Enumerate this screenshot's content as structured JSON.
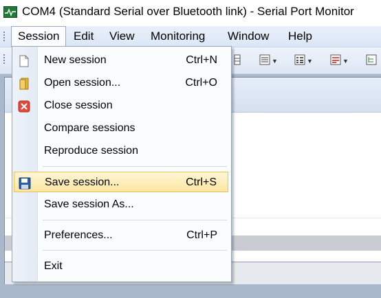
{
  "window": {
    "title": "COM4 (Standard Serial over Bluetooth link) - Serial Port Monitor"
  },
  "menubar": {
    "items": [
      {
        "label": "Session",
        "active": true
      },
      {
        "label": "Edit"
      },
      {
        "label": "View"
      },
      {
        "label": "Monitoring"
      },
      {
        "label": "Window"
      },
      {
        "label": "Help"
      }
    ]
  },
  "session_menu": {
    "items": [
      {
        "label": "New session",
        "shortcut": "Ctrl+N",
        "icon": "new-document-icon"
      },
      {
        "label": "Open session...",
        "shortcut": "Ctrl+O",
        "icon": "open-folder-icon"
      },
      {
        "label": "Close session",
        "shortcut": "",
        "icon": "close-red-x-icon"
      },
      {
        "label": "Compare sessions",
        "shortcut": ""
      },
      {
        "label": "Reproduce session",
        "shortcut": ""
      },
      {
        "label": "Save session...",
        "shortcut": "Ctrl+S",
        "icon": "floppy-disk-icon",
        "highlighted": true
      },
      {
        "label": "Save session As...",
        "shortcut": ""
      },
      {
        "label": "Preferences...",
        "shortcut": "Ctrl+P"
      },
      {
        "label": "Exit",
        "shortcut": ""
      }
    ]
  },
  "colors": {
    "menu_highlight": "#fbe7a1",
    "close_icon": "#e14a3b",
    "save_icon": "#2a5fa8"
  }
}
